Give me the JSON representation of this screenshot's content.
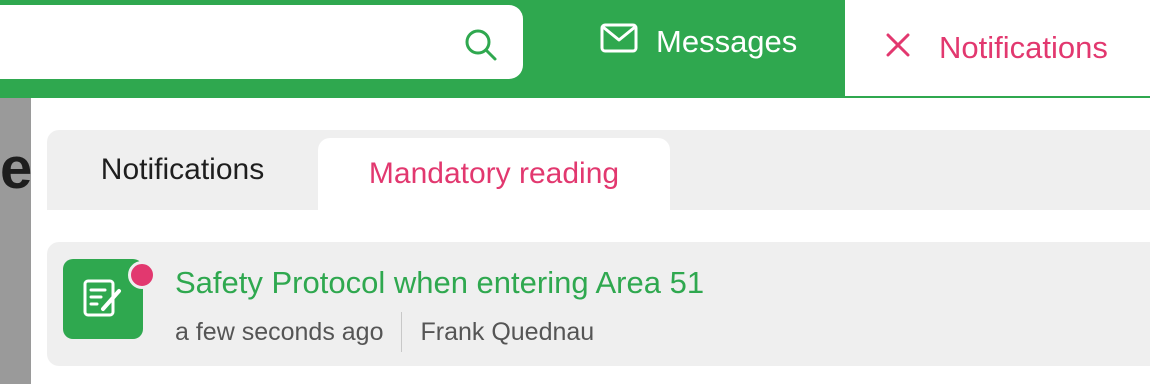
{
  "header": {
    "search": {
      "value": "",
      "icon": "search-icon"
    },
    "messages": {
      "label": "Messages",
      "icon": "envelope-icon"
    },
    "notifications": {
      "label": "Notifications",
      "icon": "close-icon"
    }
  },
  "background": {
    "partial_text": "e"
  },
  "panel": {
    "tabs": [
      {
        "label": "Notifications",
        "active": false
      },
      {
        "label": "Mandatory reading",
        "active": true
      }
    ],
    "items": [
      {
        "title": "Safety Protocol when entering Area 51",
        "time": "a few seconds ago",
        "author": "Frank Quednau",
        "icon": "document-edit-icon",
        "unread": true
      }
    ]
  },
  "colors": {
    "brand_green": "#2fa84f",
    "accent_pink": "#e2386f",
    "panel_gray": "#efefef"
  }
}
